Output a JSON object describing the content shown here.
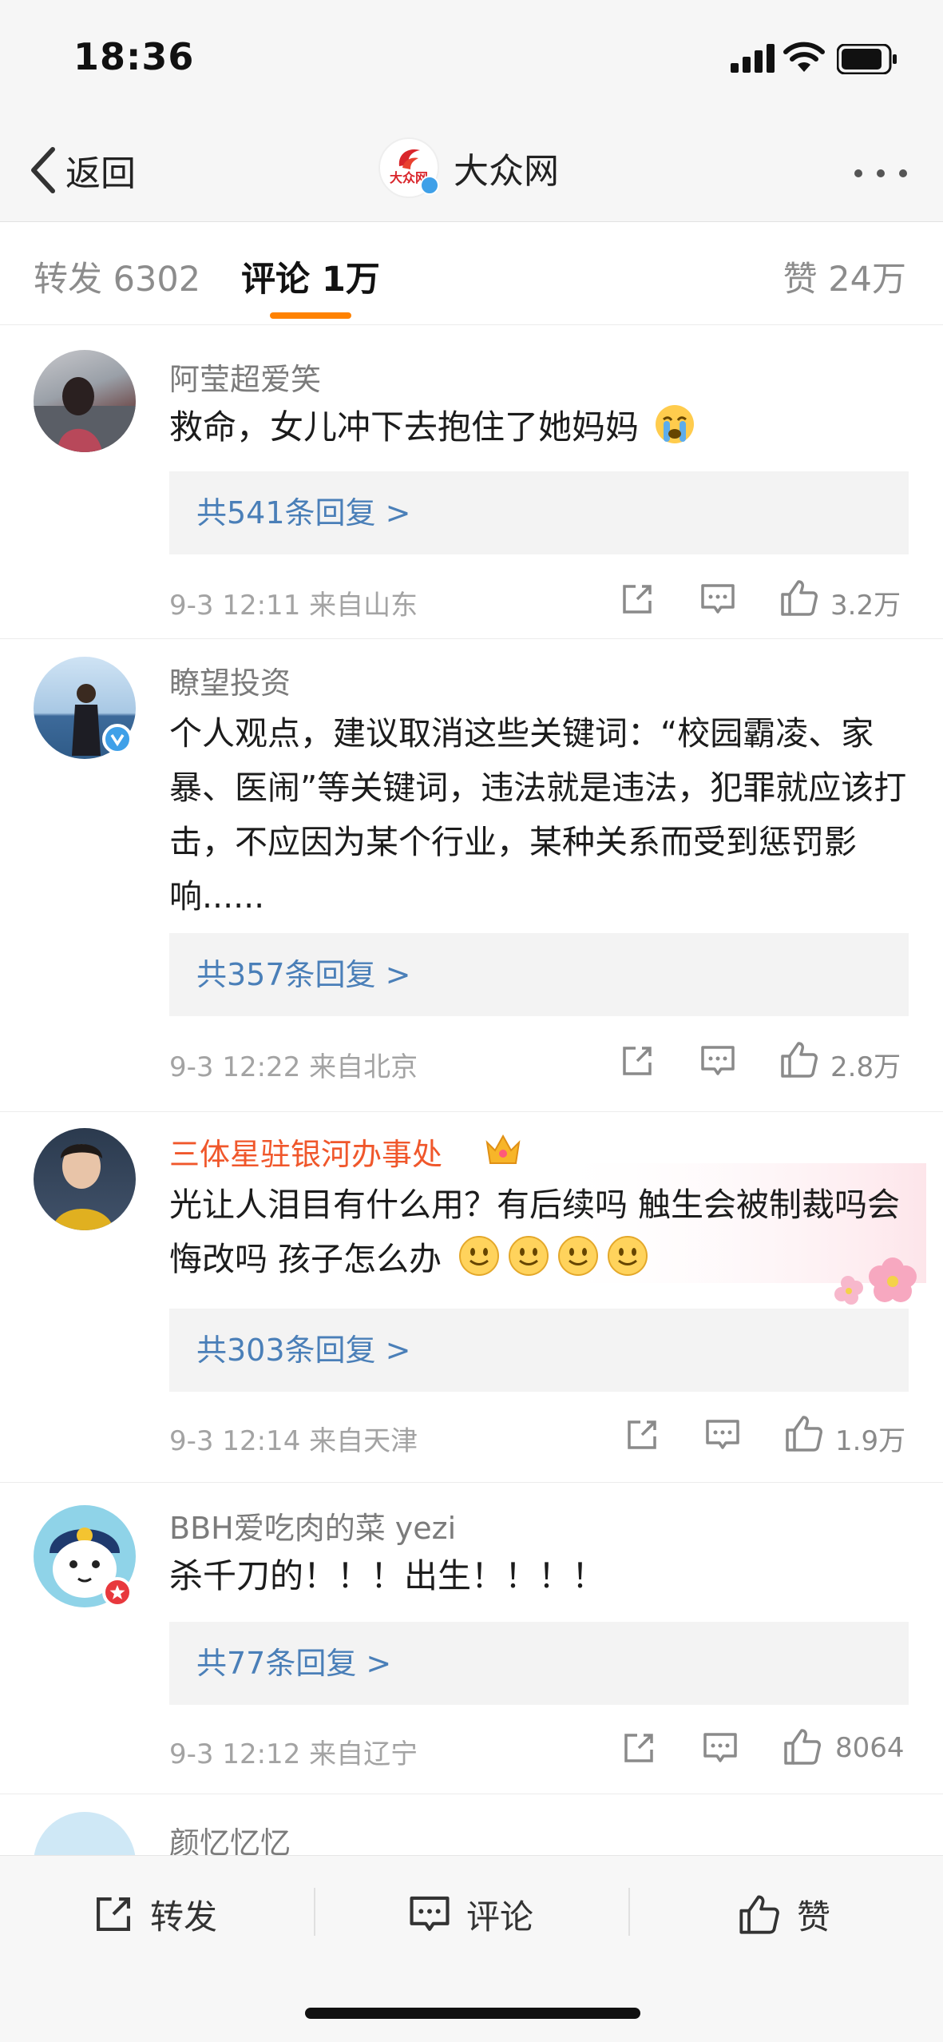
{
  "status_bar": {
    "time": "18:36"
  },
  "nav": {
    "back_label": "返回",
    "title": "大众网",
    "logo_text": "大众网"
  },
  "tabs": {
    "repost": "转发 6302",
    "comment": "评论 1万",
    "like": "赞 24万"
  },
  "comments": [
    {
      "user": "阿莹超爱笑",
      "text": "救命，女儿冲下去抱住了她妈妈",
      "emoji": "crying-face",
      "replies": "共541条回复 >",
      "meta": "9-3 12:11  来自山东",
      "likes": "3.2万"
    },
    {
      "user": "瞭望投资",
      "text": "个人观点，建议取消这些关键词：“校园霸凌、家暴、医闹”等关键词，违法就是违法，犯罪就应该打击，不应因为某个行业，某种关系而受到惩罚影响......",
      "replies": "共357条回复 >",
      "meta": "9-3 12:22  来自北京",
      "likes": "2.8万"
    },
    {
      "user": "三体星驻银河办事处",
      "text": "光让人泪目有什么用？有后续吗  触生会被制裁吗会悔改吗 孩子怎么办",
      "emoji": "smile-face",
      "replies": "共303条回复 >",
      "meta": "9-3 12:14  来自天津",
      "likes": "1.9万"
    },
    {
      "user": "BBH爱吃肉的菜 yezi",
      "text": "杀千刀的！！！出生！！！！",
      "replies": "共77条回复 >",
      "meta": "9-3 12:12  来自辽宁",
      "likes": "8064"
    },
    {
      "user": "颜忆忆忆"
    }
  ],
  "bottom_bar": {
    "repost": "转发",
    "comment": "评论",
    "like": "赞"
  },
  "colors": {
    "accent": "#ff8200",
    "link": "#4a7fb8",
    "vip_name": "#f0572b",
    "verified": "#3fa0e8"
  }
}
